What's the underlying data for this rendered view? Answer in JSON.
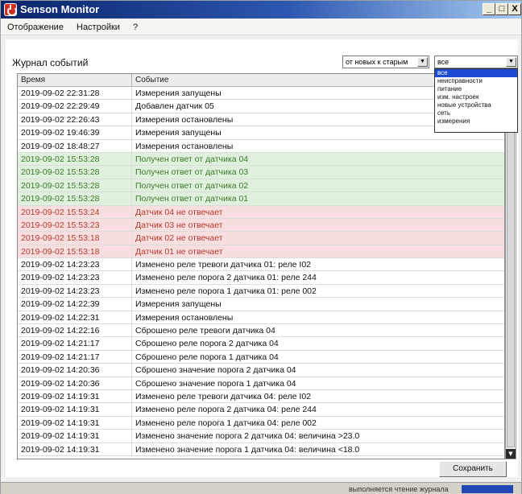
{
  "window": {
    "title": "Senson Monitor",
    "controls": {
      "minimize": "_",
      "maximize": "□",
      "close": "X"
    }
  },
  "menu": {
    "items": [
      "Отображение",
      "Настройки",
      "?"
    ]
  },
  "journal": {
    "label": "Журнал событий",
    "order_select": {
      "value": "от новых к старым"
    },
    "filter_select": {
      "value": "все",
      "options": [
        "все",
        "неисправности",
        "питание",
        "изм. настроек",
        "новые устройства",
        "сеть",
        "измерения"
      ],
      "selected_index": 0
    }
  },
  "table": {
    "columns": [
      "Время",
      "Событие"
    ],
    "rows": [
      {
        "time": "2019-09-02 22:31:28",
        "event": "Измерения запущены",
        "status": "normal"
      },
      {
        "time": "2019-09-02 22:29:49",
        "event": "Добавлен датчик 05",
        "status": "normal"
      },
      {
        "time": "2019-09-02 22:26:43",
        "event": "Измерения остановлены",
        "status": "normal"
      },
      {
        "time": "2019-09-02 19:46:39",
        "event": "Измерения запущены",
        "status": "normal"
      },
      {
        "time": "2019-09-02 18:48:27",
        "event": "Измерения остановлены",
        "status": "normal"
      },
      {
        "time": "2019-09-02 15:53:28",
        "event": "Получен ответ от датчика 04",
        "status": "ok"
      },
      {
        "time": "2019-09-02 15:53:28",
        "event": "Получен ответ от датчика 03",
        "status": "ok"
      },
      {
        "time": "2019-09-02 15:53:28",
        "event": "Получен ответ от датчика 02",
        "status": "ok"
      },
      {
        "time": "2019-09-02 15:53:28",
        "event": "Получен ответ от датчика 01",
        "status": "ok"
      },
      {
        "time": "2019-09-02 15:53:24",
        "event": "Датчик 04 не отвечает",
        "status": "err"
      },
      {
        "time": "2019-09-02 15:53:23",
        "event": "Датчик 03 не отвечает",
        "status": "err"
      },
      {
        "time": "2019-09-02 15:53:18",
        "event": "Датчик 02 не отвечает",
        "status": "err"
      },
      {
        "time": "2019-09-02 15:53:18",
        "event": "Датчик 01 не отвечает",
        "status": "err"
      },
      {
        "time": "2019-09-02 14:23:23",
        "event": "Изменено реле тревоги датчика 01: реле I02",
        "status": "normal"
      },
      {
        "time": "2019-09-02 14:23:23",
        "event": "Изменено реле порога 2 датчика 01: реле 244",
        "status": "normal"
      },
      {
        "time": "2019-09-02 14:23:23",
        "event": "Изменено реле порога 1 датчика 01: реле 002",
        "status": "normal"
      },
      {
        "time": "2019-09-02 14:22:39",
        "event": "Измерения запущены",
        "status": "normal"
      },
      {
        "time": "2019-09-02 14:22:31",
        "event": "Измерения остановлены",
        "status": "normal"
      },
      {
        "time": "2019-09-02 14:22:16",
        "event": "Сброшено реле тревоги датчика 04",
        "status": "normal"
      },
      {
        "time": "2019-09-02 14:21:17",
        "event": "Сброшено реле порога 2 датчика 04",
        "status": "normal"
      },
      {
        "time": "2019-09-02 14:21:17",
        "event": "Сброшено реле порога 1 датчика 04",
        "status": "normal"
      },
      {
        "time": "2019-09-02 14:20:36",
        "event": "Сброшено значение порога 2 датчика 04",
        "status": "normal"
      },
      {
        "time": "2019-09-02 14:20:36",
        "event": "Сброшено значение порога 1 датчика 04",
        "status": "normal"
      },
      {
        "time": "2019-09-02 14:19:31",
        "event": "Изменено реле тревоги датчика 04: реле I02",
        "status": "normal"
      },
      {
        "time": "2019-09-02 14:19:31",
        "event": "Изменено реле порога 2 датчика 04: реле 244",
        "status": "normal"
      },
      {
        "time": "2019-09-02 14:19:31",
        "event": "Изменено реле порога 1 датчика 04: реле 002",
        "status": "normal"
      },
      {
        "time": "2019-09-02 14:19:31",
        "event": "Изменено значение порога 2 датчика 04: величина >23.0",
        "status": "normal"
      },
      {
        "time": "2019-09-02 14:19:31",
        "event": "Изменено значение порога 1 датчика 04: величина <18.0",
        "status": "normal"
      }
    ]
  },
  "buttons": {
    "save": "Сохранить"
  },
  "status": {
    "text": "выполняется чтение журнала"
  },
  "colors": {
    "ok_row": "#dff0dc",
    "err_row": "#f8dede",
    "selection": "#1c4bd1"
  },
  "icons": {
    "app": "power-icon",
    "scroll_up": "arrow-up-icon",
    "scroll_down": "arrow-down-icon"
  }
}
